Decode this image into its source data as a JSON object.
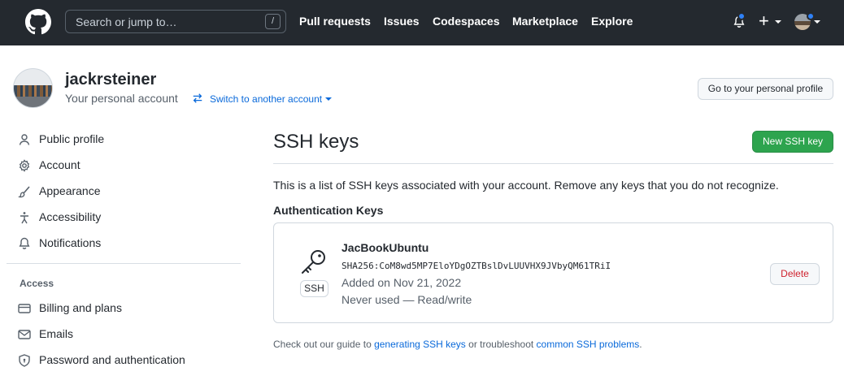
{
  "header": {
    "search_placeholder": "Search or jump to…",
    "search_shortcut": "/",
    "nav": [
      "Pull requests",
      "Issues",
      "Codespaces",
      "Marketplace",
      "Explore"
    ],
    "plus_symbol": "+",
    "icons": [
      "github-logo",
      "bell-icon",
      "plus-icon",
      "avatar"
    ]
  },
  "account": {
    "username": "jackrsteiner",
    "subtitle": "Your personal account",
    "switch_link": "Switch to another account",
    "profile_button": "Go to your personal profile"
  },
  "sidebar": {
    "items": [
      {
        "label": "Public profile",
        "icon": "person-icon"
      },
      {
        "label": "Account",
        "icon": "gear-icon"
      },
      {
        "label": "Appearance",
        "icon": "paintbrush-icon"
      },
      {
        "label": "Accessibility",
        "icon": "accessibility-icon"
      },
      {
        "label": "Notifications",
        "icon": "bell-icon"
      }
    ],
    "access_heading": "Access",
    "access_items": [
      {
        "label": "Billing and plans",
        "icon": "credit-card-icon"
      },
      {
        "label": "Emails",
        "icon": "mail-icon"
      },
      {
        "label": "Password and authentication",
        "icon": "shield-lock-icon"
      }
    ]
  },
  "main": {
    "title": "SSH keys",
    "new_button": "New SSH key",
    "description": "This is a list of SSH keys associated with your account. Remove any keys that you do not recognize.",
    "section_heading": "Authentication Keys",
    "key": {
      "type_label": "SSH",
      "title": "JacBookUbuntu",
      "fingerprint": "SHA256:CoM8wd5MP7EloYDgOZTBslDvLUUVHX9JVbyQM61TRiI",
      "added": "Added on Nov 21, 2022",
      "usage": "Never used — Read/write",
      "delete_button": "Delete"
    },
    "footer": {
      "prefix": "Check out our guide to ",
      "link1": "generating SSH keys",
      "middle": " or troubleshoot ",
      "link2": "common SSH problems",
      "suffix": "."
    }
  },
  "colors": {
    "header_bg": "#24292f",
    "accent_blue": "#0969da",
    "primary_green": "#2da44e",
    "danger_red": "#cf222e",
    "notification_dot": "#2f81f7"
  }
}
